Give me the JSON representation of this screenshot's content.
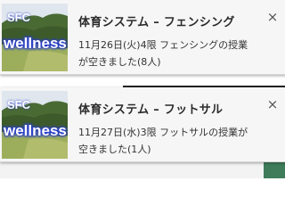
{
  "notifications": [
    {
      "logo_top": "SFC",
      "logo_main": "wellness",
      "title": "体育システム – フェンシング",
      "body": "11月26日(火)4限 フェンシングの授業が空きました(8人)",
      "close_label": "×"
    },
    {
      "logo_top": "SFC",
      "logo_main": "wellness",
      "title": "体育システム – フットサル",
      "body": "11月27日(水)3限 フットサルの授業が空きました(1人)",
      "close_label": "×"
    }
  ],
  "colors": {
    "logo_text": "#ffffff",
    "logo_glow": "#2a3fc8",
    "sky": "#dfe6ee",
    "trees": "#3d5a2a",
    "grass": "#9cae5c"
  }
}
